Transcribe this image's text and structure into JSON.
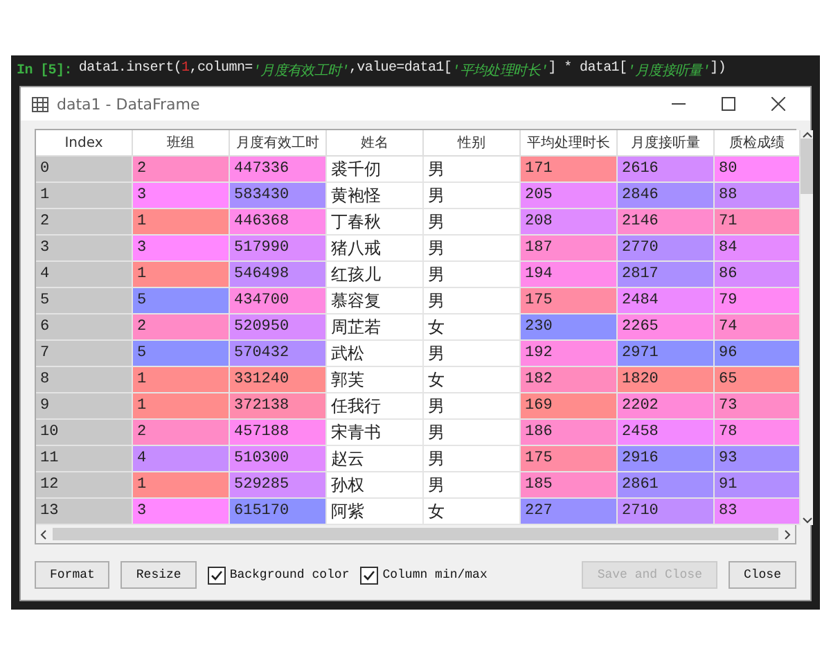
{
  "code_cell": {
    "prompt": "In [5]:",
    "segments": [
      {
        "kind": "code",
        "text": "data1.insert("
      },
      {
        "kind": "number",
        "text": "1"
      },
      {
        "kind": "code",
        "text": ",column="
      },
      {
        "kind": "string",
        "text": "'月度有效工时'"
      },
      {
        "kind": "code",
        "text": ",value=data1["
      },
      {
        "kind": "string",
        "text": "'平均处理时长'"
      },
      {
        "kind": "code",
        "text": "] * data1["
      },
      {
        "kind": "string",
        "text": "'月度接听量'"
      },
      {
        "kind": "code",
        "text": "])"
      }
    ]
  },
  "window": {
    "title": "data1 - DataFrame"
  },
  "table": {
    "columns": [
      {
        "label": "Index",
        "kind": "index"
      },
      {
        "label": "班组",
        "kind": "numeric"
      },
      {
        "label": "月度有效工时",
        "kind": "numeric"
      },
      {
        "label": "姓名",
        "kind": "text"
      },
      {
        "label": "性别",
        "kind": "text"
      },
      {
        "label": "平均处理时长",
        "kind": "numeric"
      },
      {
        "label": "月度接听量",
        "kind": "numeric"
      },
      {
        "label": "质检成绩",
        "kind": "numeric"
      }
    ],
    "rows": [
      [
        "0",
        "2",
        "447336",
        "裘千仞",
        "男",
        "171",
        "2616",
        "80"
      ],
      [
        "1",
        "3",
        "583430",
        "黄袍怪",
        "男",
        "205",
        "2846",
        "88"
      ],
      [
        "2",
        "1",
        "446368",
        "丁春秋",
        "男",
        "208",
        "2146",
        "71"
      ],
      [
        "3",
        "3",
        "517990",
        "猪八戒",
        "男",
        "187",
        "2770",
        "84"
      ],
      [
        "4",
        "1",
        "546498",
        "红孩儿",
        "男",
        "194",
        "2817",
        "86"
      ],
      [
        "5",
        "5",
        "434700",
        "慕容复",
        "男",
        "175",
        "2484",
        "79"
      ],
      [
        "6",
        "2",
        "520950",
        "周芷若",
        "女",
        "230",
        "2265",
        "74"
      ],
      [
        "7",
        "5",
        "570432",
        "武松",
        "男",
        "192",
        "2971",
        "96"
      ],
      [
        "8",
        "1",
        "331240",
        "郭芙",
        "女",
        "182",
        "1820",
        "65"
      ],
      [
        "9",
        "1",
        "372138",
        "任我行",
        "男",
        "169",
        "2202",
        "73"
      ],
      [
        "10",
        "2",
        "457188",
        "宋青书",
        "男",
        "186",
        "2458",
        "78"
      ],
      [
        "11",
        "4",
        "510300",
        "赵云",
        "男",
        "175",
        "2916",
        "93"
      ],
      [
        "12",
        "1",
        "529285",
        "孙权",
        "男",
        "185",
        "2861",
        "91"
      ],
      [
        "13",
        "3",
        "615170",
        "阿紫",
        "女",
        "227",
        "2710",
        "83"
      ]
    ]
  },
  "buttons": [
    {
      "label": "Format",
      "disabled": false
    },
    {
      "label": "Resize",
      "disabled": false
    }
  ],
  "checkboxes": [
    {
      "label": "Background color",
      "checked": true
    },
    {
      "label": "Column min/max",
      "checked": true
    }
  ],
  "right_buttons": [
    {
      "label": "Save and Close",
      "disabled": true
    },
    {
      "label": "Close",
      "disabled": false
    }
  ]
}
